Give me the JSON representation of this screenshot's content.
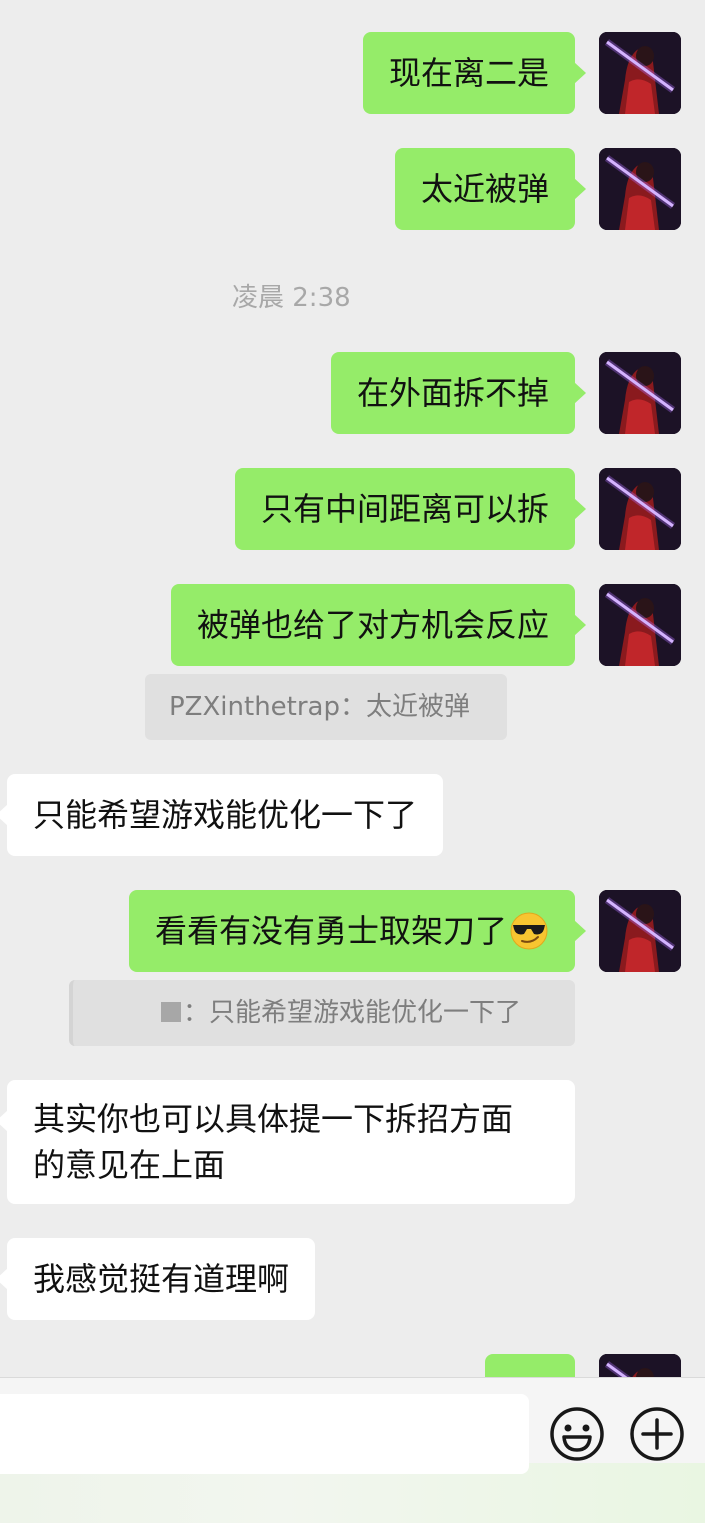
{
  "messages": [
    {
      "side": "me",
      "text": "现在离二是"
    },
    {
      "side": "me",
      "text": "太近被弹"
    },
    {
      "side": "time",
      "text": "凌晨 2:38"
    },
    {
      "side": "me",
      "text": "在外面拆不掉"
    },
    {
      "side": "me",
      "text": "只有中间距离可以拆"
    },
    {
      "side": "me",
      "text": "被弹也给了对方机会反应",
      "quote": "PZXinthetrap：太近被弹"
    },
    {
      "side": "other",
      "text": "只能希望游戏能优化一下了"
    },
    {
      "side": "me",
      "text": "看看有没有勇士取架刀了",
      "emoji": "smirk-sunglasses-emoji",
      "quote": "：只能希望游戏能优化一下了"
    },
    {
      "side": "other",
      "text_line1": "其实你也可以具体提一下拆招方面",
      "text_line2": "的意见在上面"
    },
    {
      "side": "other",
      "text": "我感觉挺有道理啊"
    },
    {
      "side": "me",
      "text": ""
    }
  ],
  "input": {
    "value": "",
    "icons": [
      "emoji-icon",
      "plus-icon"
    ]
  },
  "colors": {
    "background": "#ededed",
    "my_bubble": "#95ec69",
    "other_bubble": "#ffffff",
    "quote_bg": "#e0e0e0",
    "timestamp": "#a8a8a8"
  }
}
